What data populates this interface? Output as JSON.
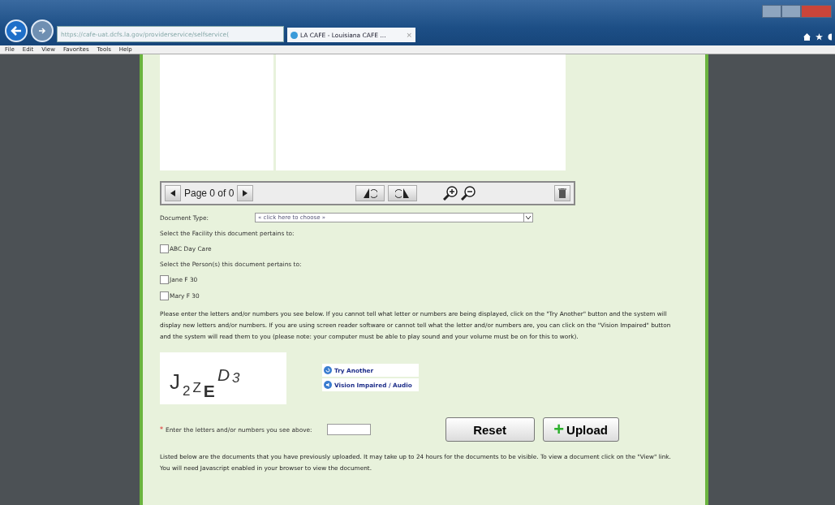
{
  "browser": {
    "address": "https://cafe-uat.dcfs.la.gov/providerservice/selfservice(",
    "tab_title": "LA CAFE - Louisiana CAFE ...",
    "tab_close": "×",
    "menu": [
      "File",
      "Edit",
      "View",
      "Favorites",
      "Tools",
      "Help"
    ]
  },
  "viewer": {
    "page_label": "Page 0 of 0"
  },
  "document_type": {
    "label": "Document Type:",
    "value": "« click here to choose »"
  },
  "facility": {
    "prompt": "Select the Facility this document pertains to:",
    "items": [
      {
        "label": "ABC Day Care",
        "checked": false
      }
    ]
  },
  "persons": {
    "prompt": "Select the Person(s) this document pertains to:",
    "items": [
      {
        "label": "Jane F 30",
        "checked": false
      },
      {
        "label": "Mary F 30",
        "checked": false
      }
    ]
  },
  "instructions": "Please enter the letters and/or numbers you see below. If you cannot tell what letter or numbers are being displayed, click on the \"Try Another\" button and the system will display new letters and/or numbers. If you are using screen reader software or cannot tell what the letter and/or numbers are, you can click on the \"Vision Impaired\" button and the system will read them to you (please note: your computer must be able to play sound and your volume must be on for this to work).",
  "captcha": [
    "J",
    "2",
    "Z",
    "E",
    "D",
    "3"
  ],
  "captcha_links": [
    {
      "label": "Try Another",
      "kind": "refresh"
    },
    {
      "label": "Vision Impaired / Audio",
      "kind": "audio"
    }
  ],
  "entry": {
    "required_mark": "*",
    "label": "Enter the letters and/or numbers you see above:"
  },
  "buttons": [
    {
      "label": "Reset",
      "kind": "plain"
    },
    {
      "label": "Upload",
      "kind": "add",
      "icon_text": "+"
    }
  ],
  "footer_note": "Listed below are the documents that you have previously uploaded. It may take up to 24 hours for the documents to be visible. To view a document click on the \"View\" link. You will need Javascript enabled in your browser to view the document."
}
